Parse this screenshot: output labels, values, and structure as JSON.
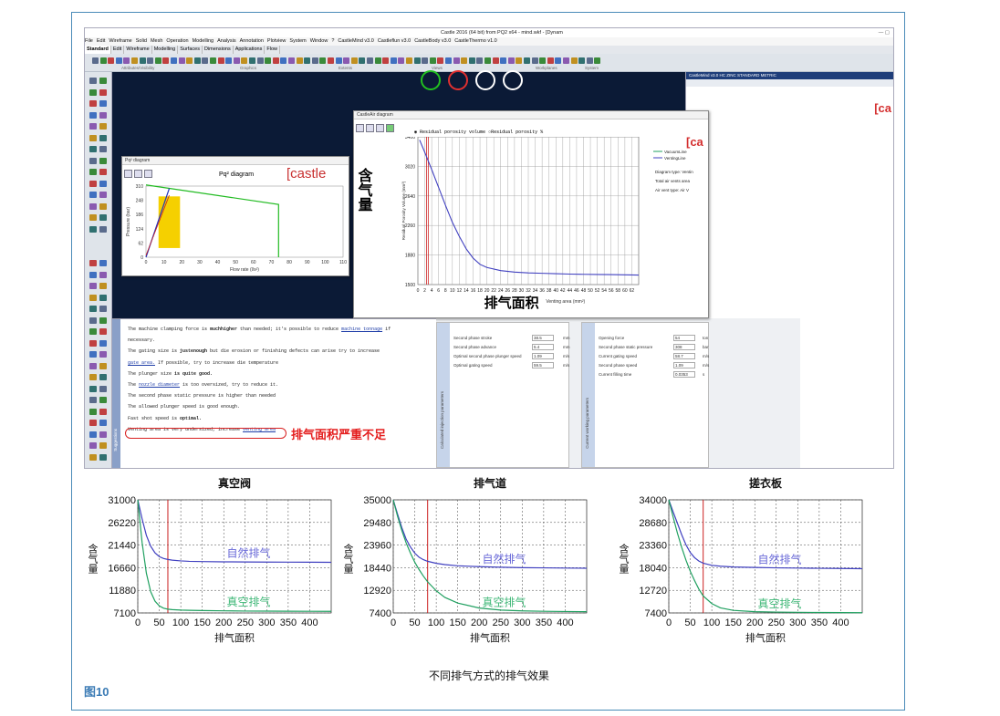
{
  "app": {
    "window_title": "Castle 2016 (64 bit) from PQ2 x64 - mind.wkf - [Dynam",
    "window_controls": "—   ▢"
  },
  "menu": [
    "File",
    "Edit",
    "Wireframe",
    "Solid",
    "Mesh",
    "Operation",
    "Modelling",
    "Analysis",
    "Annotation",
    "Plotview",
    "System",
    "Window",
    "?",
    "CastleMind v3.0",
    "Castleflun v3.0",
    "CastleBody v3.0",
    "CastleThermo v1.0"
  ],
  "tabs": [
    "Standard",
    "Edit",
    "Wireframe",
    "Modelling",
    "Surfaces",
    "Dimensions",
    "Applications",
    "Flow"
  ],
  "toolbar_groups": {
    "attributes": "Attributes/Visibility",
    "graphics": "Graphics",
    "extents": "Extents",
    "views": "Views",
    "workplanes": "Workplanes",
    "system": "System"
  },
  "castlemind_panel": {
    "title": "CastleMind v3.0 HC ZINC STANDARD METRIC",
    "logo": "[ca"
  },
  "pq_dialog": {
    "window_title": "Pq² diagram",
    "heading": "Pq² diagram",
    "logo": "[castle",
    "y_label": "Pressure (bar)",
    "x_label": "Flow rate (l/s²)",
    "y_ticks": [
      "310",
      "248",
      "186",
      "124",
      "62",
      "0"
    ],
    "x_ticks": [
      "0",
      "10",
      "20",
      "30",
      "40",
      "50",
      "60",
      "70",
      "80",
      "90",
      "100",
      "110"
    ]
  },
  "castleair_dialog": {
    "window_title": "CastleAir diagram",
    "radio_1": "Residual porosity volume",
    "radio_2": "Residual porosity %",
    "logo": "[ca",
    "legend": [
      "VacuumLine",
      "VentingLine"
    ],
    "info": [
      "Diagram type: Ventin",
      "Total air vents area",
      "Air vent type: Air V"
    ],
    "y_label": "Residual Porosity Volume (mm³)",
    "x_label": "Venting area (mm²)",
    "overlay_y": "含气量",
    "overlay_x": "排气面积"
  },
  "chart_data": [
    {
      "type": "line",
      "title": "",
      "xlabel": "Venting area (mm²)",
      "ylabel": "Residual Porosity Volume (mm³)",
      "ylim": [
        1500,
        3400
      ],
      "xlim": [
        0,
        64
      ],
      "y_ticks": [
        1500,
        1880,
        2260,
        2640,
        3020,
        3400
      ],
      "x_ticks": [
        0,
        2,
        4,
        6,
        8,
        10,
        12,
        14,
        16,
        18,
        20,
        22,
        24,
        26,
        28,
        30,
        32,
        34,
        36,
        38,
        40,
        42,
        44,
        46,
        48,
        50,
        52,
        54,
        56,
        58,
        60,
        62
      ],
      "x": [
        0.5,
        2,
        4,
        6,
        8,
        10,
        12,
        14,
        16,
        18,
        20,
        24,
        28,
        32,
        36,
        40,
        44,
        48,
        52,
        56,
        60,
        64
      ],
      "series": [
        {
          "name": "VentingLine",
          "values": [
            3360,
            3200,
            2980,
            2750,
            2520,
            2300,
            2120,
            1960,
            1840,
            1760,
            1720,
            1680,
            1660,
            1650,
            1645,
            1640,
            1635,
            1632,
            1630,
            1628,
            1625,
            1623
          ]
        }
      ],
      "markers": [
        2.5,
        3.0
      ],
      "grid": true,
      "legend": "right"
    },
    {
      "type": "line",
      "title": "真空阀",
      "xlabel": "排气面积",
      "ylabel": "含气量",
      "ylim": [
        7100,
        31000
      ],
      "xlim": [
        0,
        450
      ],
      "y_ticks": [
        7100,
        11880,
        16660,
        21440,
        26220,
        31000
      ],
      "x_ticks": [
        0,
        50,
        100,
        150,
        200,
        250,
        300,
        350,
        400
      ],
      "x": [
        0,
        10,
        20,
        30,
        40,
        50,
        60,
        70,
        80,
        100,
        120,
        150,
        200,
        250,
        300,
        350,
        400,
        450
      ],
      "series": [
        {
          "name": "自然排气",
          "values": [
            31000,
            27000,
            23500,
            21200,
            19800,
            19000,
            18600,
            18400,
            18250,
            18100,
            18000,
            17950,
            17900,
            17870,
            17850,
            17830,
            17820,
            17800
          ]
        },
        {
          "name": "真空排气",
          "values": [
            31000,
            22000,
            15500,
            11600,
            9600,
            8600,
            8100,
            7900,
            7800,
            7700,
            7650,
            7600,
            7550,
            7500,
            7480,
            7460,
            7450,
            7440
          ]
        }
      ],
      "markers": [
        70
      ],
      "grid": true
    },
    {
      "type": "line",
      "title": "排气道",
      "xlabel": "排气面积",
      "ylabel": "含气量",
      "ylim": [
        7400,
        35000
      ],
      "xlim": [
        0,
        450
      ],
      "y_ticks": [
        7400,
        12920,
        18440,
        23960,
        29480,
        35000
      ],
      "x_ticks": [
        0,
        50,
        100,
        150,
        200,
        250,
        300,
        350,
        400
      ],
      "x": [
        0,
        10,
        20,
        30,
        40,
        50,
        60,
        70,
        80,
        100,
        120,
        150,
        200,
        250,
        300,
        350,
        400,
        450
      ],
      "series": [
        {
          "name": "自然排气",
          "values": [
            35000,
            31500,
            28200,
            25400,
            23500,
            22000,
            21000,
            20400,
            20000,
            19500,
            19200,
            18900,
            18700,
            18550,
            18450,
            18400,
            18350,
            18300
          ]
        },
        {
          "name": "真空排气",
          "values": [
            35000,
            31000,
            27500,
            24500,
            22000,
            19800,
            18000,
            16400,
            15000,
            12800,
            11200,
            9800,
            8600,
            8100,
            7900,
            7800,
            7750,
            7700
          ]
        }
      ],
      "markers": [
        80
      ],
      "grid": true
    },
    {
      "type": "line",
      "title": "搓衣板",
      "xlabel": "排气面积",
      "ylabel": "含气量",
      "ylim": [
        7400,
        34000
      ],
      "xlim": [
        0,
        450
      ],
      "y_ticks": [
        7400,
        12720,
        18040,
        23360,
        28680,
        34000
      ],
      "x_ticks": [
        0,
        50,
        100,
        150,
        200,
        250,
        300,
        350,
        400
      ],
      "x": [
        0,
        10,
        20,
        30,
        40,
        50,
        60,
        70,
        80,
        100,
        120,
        150,
        200,
        250,
        300,
        350,
        400,
        450
      ],
      "series": [
        {
          "name": "自然排气",
          "values": [
            34000,
            31200,
            28500,
            25800,
            23400,
            21600,
            20400,
            19600,
            19100,
            18600,
            18400,
            18200,
            18100,
            18000,
            17950,
            17900,
            17850,
            17800
          ]
        },
        {
          "name": "真空排气",
          "values": [
            34000,
            30000,
            26200,
            22800,
            19800,
            17200,
            15000,
            13000,
            11400,
            9600,
            8600,
            8000,
            7700,
            7600,
            7550,
            7500,
            7480,
            7450
          ]
        }
      ],
      "markers": [
        80
      ],
      "grid": true
    }
  ],
  "suggestions": {
    "panel_label": "Suggestions",
    "lines": [
      {
        "a": "The  machine  clamping  force  is ",
        "b": "muchhigher",
        "c": " than  needed;  it's  possible  to  reduce ",
        "link": "machine tonnage",
        "d": "  if"
      },
      {
        "a": "necessary.",
        "b": "",
        "c": "",
        "link": "",
        "d": ""
      },
      {
        "a": "The  gating  size  is ",
        "b": "justenough",
        "c": " but  die  erosion  or  finishing  defects  can  arise  try  to  increase",
        "link": "",
        "d": ""
      },
      {
        "a": "",
        "b": "",
        "c": "",
        "link": "gate area.",
        "d": "  If  possible,  try  to  increase  die temperature"
      },
      {
        "a": "The  plunger  size  ",
        "b": "is quite good.",
        "c": "",
        "link": "",
        "d": ""
      },
      {
        "a": "The  ",
        "b": "",
        "c": "",
        "link": "nozzle diameter",
        "d": "  is  too  oversized,  try  to  reduce  it."
      },
      {
        "a": "The  second  phase  static  pressure  is  higher  than  needed",
        "b": "",
        "c": "",
        "link": "",
        "d": ""
      },
      {
        "a": "The  allowed  plunger  speed  is  good  enough.",
        "b": "",
        "c": "",
        "link": "",
        "d": ""
      },
      {
        "a": "Fast  shot  speed  is  ",
        "b": "optimal.",
        "c": "",
        "link": "",
        "d": ""
      },
      {
        "a": "Venting  area  is  very  undersized,  increase  ",
        "b": "",
        "c": "",
        "link": "venting area",
        "d": ""
      }
    ],
    "annotation": "排气面积严重不足"
  },
  "calc_params": {
    "label": "Calculated injection parameters",
    "rows": [
      {
        "name": "Second phase stroke",
        "value": "38.5",
        "unit": "mm"
      },
      {
        "name": "Second phase advance",
        "value": "5.4",
        "unit": "mm"
      },
      {
        "name": "Optimal second phase plunger speed",
        "value": "1.09",
        "unit": "m/s"
      },
      {
        "name": "Optimal gating speed",
        "value": "59.5",
        "unit": "m/s"
      }
    ]
  },
  "work_params": {
    "label": "Current working parameters",
    "rows": [
      {
        "name": "Opening force",
        "value": "54",
        "unit": "ton"
      },
      {
        "name": "Second phase static pressure",
        "value": "308",
        "unit": "bar"
      },
      {
        "name": "Current gating speed",
        "value": "58.7",
        "unit": "m/s"
      },
      {
        "name": "Second phase speed",
        "value": "1.09",
        "unit": "m/s"
      },
      {
        "name": "Current filling time",
        "value": "0.0353",
        "unit": "s"
      }
    ]
  },
  "colors": {
    "venting": "#4040c0",
    "vacuum": "#20a060",
    "marker": "#cc2020",
    "pq_line": "#22bb22",
    "pq_area": "#f5d000",
    "nav": "#22c020"
  },
  "figure": {
    "caption": "不同排气方式的排气效果",
    "label": "图10"
  }
}
